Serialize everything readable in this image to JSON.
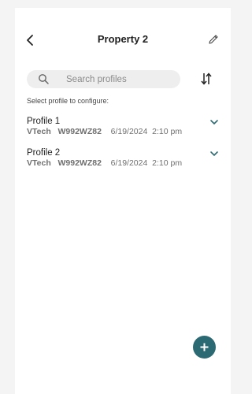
{
  "header": {
    "title": "Property 2"
  },
  "search": {
    "placeholder": "Search profiles"
  },
  "hint": "Select profile to configure:",
  "profiles": [
    {
      "name": "Profile 1",
      "brand": "VTech",
      "model": "W992WZ82",
      "date": "6/19/2024",
      "time": "2:10 pm"
    },
    {
      "name": "Profile 2",
      "brand": "VTech",
      "model": "W992WZ82",
      "date": "6/19/2024",
      "time": "2:10 pm"
    }
  ],
  "colors": {
    "accent": "#2c6a73",
    "chevron": "#2c6a73"
  },
  "icons": [
    "back-arrow-icon",
    "edit-pencil-icon",
    "search-icon",
    "sort-icon",
    "chevron-down-icon",
    "plus-icon"
  ]
}
